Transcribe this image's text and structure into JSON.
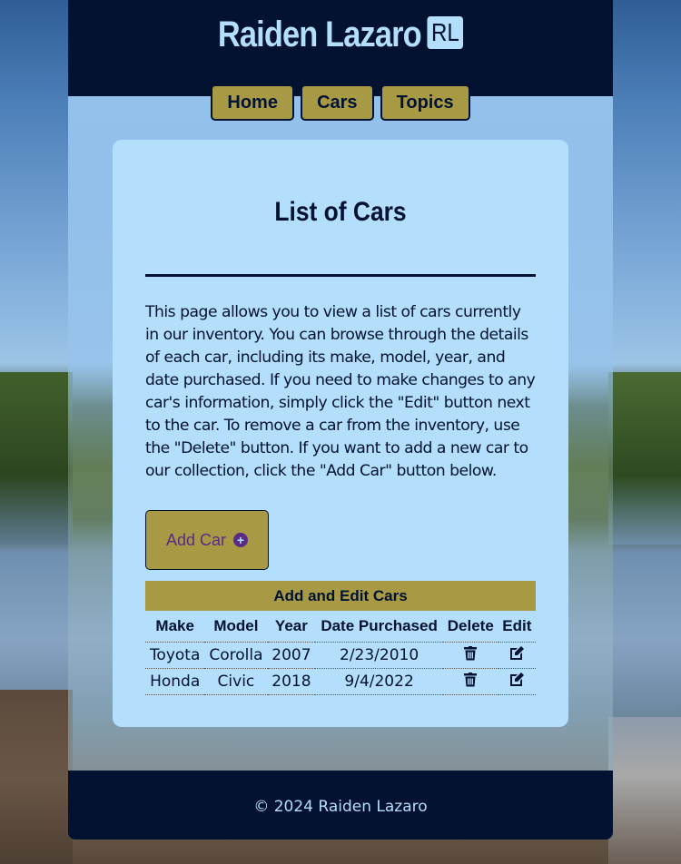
{
  "header": {
    "title": "Raiden Lazaro",
    "badge": "RL"
  },
  "nav": {
    "items": [
      "Home",
      "Cars",
      "Topics"
    ]
  },
  "main": {
    "title": "List of Cars",
    "description": "This page allows you to view a list of cars currently in our inventory. You can browse through the details of each car, including its make, model, year, and date purchased. If you need to make changes to any car's information, simply click the \"Edit\" button next to the car. To remove a car from the inventory, use the \"Delete\" button. If you want to add a new car to our collection, click the \"Add Car\" button below.",
    "add_button": "Add Car",
    "table": {
      "caption": "Add and Edit Cars",
      "columns": [
        "Make",
        "Model",
        "Year",
        "Date Purchased",
        "Delete",
        "Edit"
      ],
      "rows": [
        {
          "make": "Toyota",
          "model": "Corolla",
          "year": "2007",
          "date": "2/23/2010"
        },
        {
          "make": "Honda",
          "model": "Civic",
          "year": "2018",
          "date": "9/4/2022"
        }
      ]
    }
  },
  "footer": {
    "text": "© 2024 Raiden Lazaro"
  },
  "icons": {
    "delete": "trash-icon",
    "edit": "pen-to-square-icon",
    "add": "circle-plus-icon"
  },
  "colors": {
    "navy": "#021230",
    "light_blue": "#b3defc",
    "gold": "#a89a45",
    "purple": "#5a2a86"
  }
}
